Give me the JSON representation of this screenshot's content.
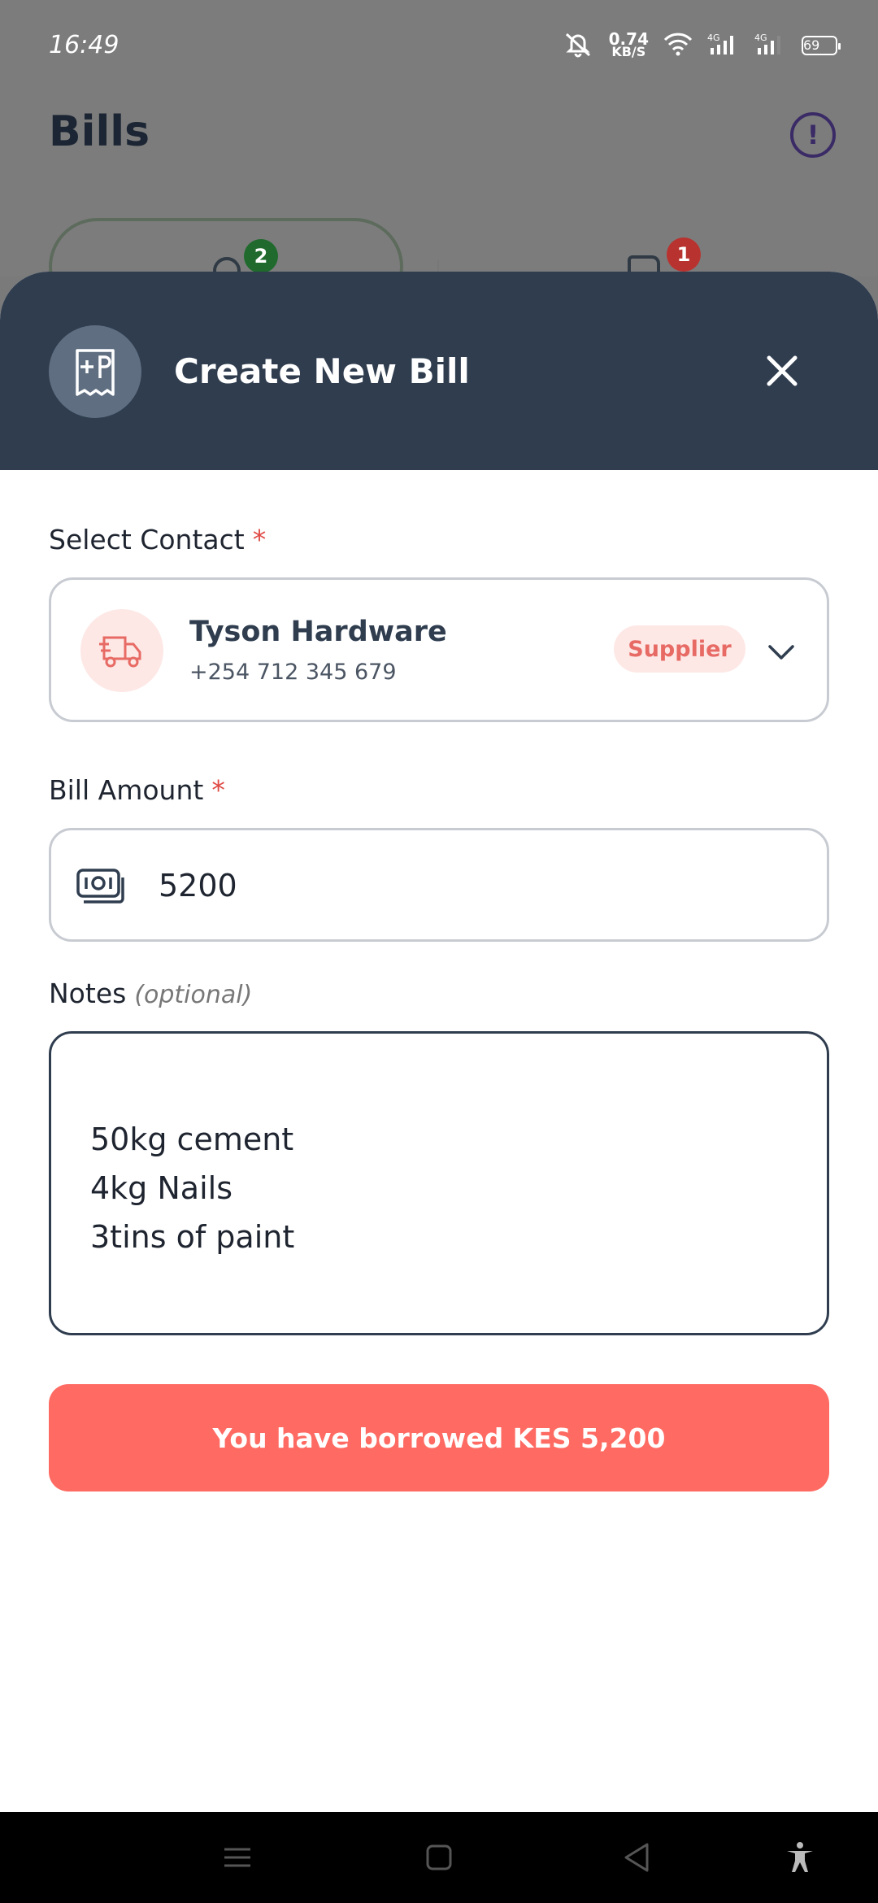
{
  "status_bar": {
    "time": "16:49",
    "net_speed_value": "0.74",
    "net_speed_unit": "KB/S",
    "network_1": "4G",
    "network_2": "4G",
    "battery": "69"
  },
  "background": {
    "title": "Bills",
    "badge_left": "2",
    "badge_right": "1"
  },
  "sheet": {
    "title": "Create New Bill"
  },
  "form": {
    "contact_label": "Select Contact",
    "required_mark": "*",
    "contact": {
      "name": "Tyson Hardware",
      "phone": "+254 712 345 679",
      "tag": "Supplier"
    },
    "amount_label": "Bill Amount",
    "amount_value": "5200",
    "notes_label": "Notes",
    "notes_optional": "(optional)",
    "notes_lines": [
      "50kg cement",
      "4kg Nails",
      "3tins of paint"
    ],
    "cta_label": "You have borrowed KES 5,200"
  },
  "colors": {
    "header": "#2f3d4f",
    "accent": "#ff6b63",
    "tag_bg": "#fde8e6"
  }
}
